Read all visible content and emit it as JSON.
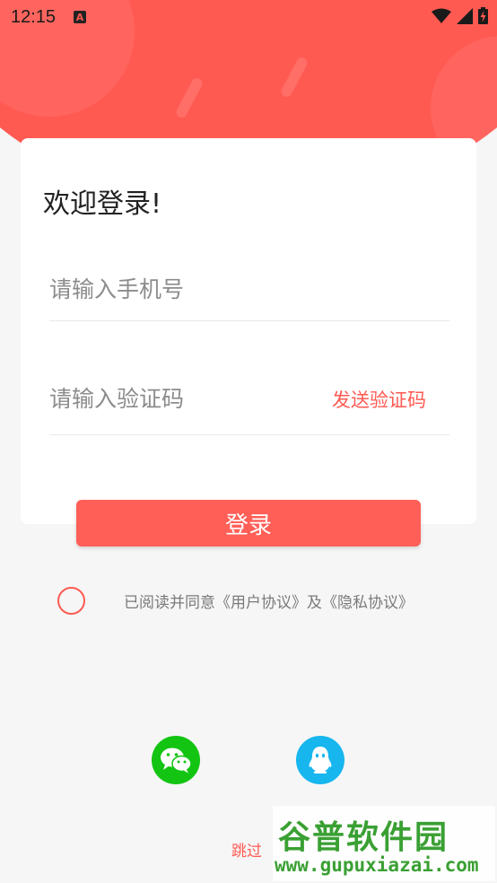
{
  "status_bar": {
    "time": "12:15",
    "notification_badge": "A"
  },
  "card": {
    "welcome": "欢迎登录!",
    "phone_placeholder": "请输入手机号",
    "code_placeholder": "请输入验证码",
    "send_code_label": "发送验证码"
  },
  "login_button_label": "登录",
  "agreement": {
    "prefix": "已阅读并同意",
    "user_agreement": "《用户协议》",
    "and": "及",
    "privacy_policy": "《隐私协议》"
  },
  "social": {
    "wechat_icon": "wechat-icon",
    "qq_icon": "qq-icon"
  },
  "skip_label": "跳过",
  "watermark": {
    "logo_text": "谷普软件园",
    "url": "www.gupuxiazai.com"
  },
  "colors": {
    "brand_red": "#ff5a52",
    "wechat_green": "#13c413",
    "qq_blue": "#17b6ee",
    "background": "#f6f6f6"
  }
}
